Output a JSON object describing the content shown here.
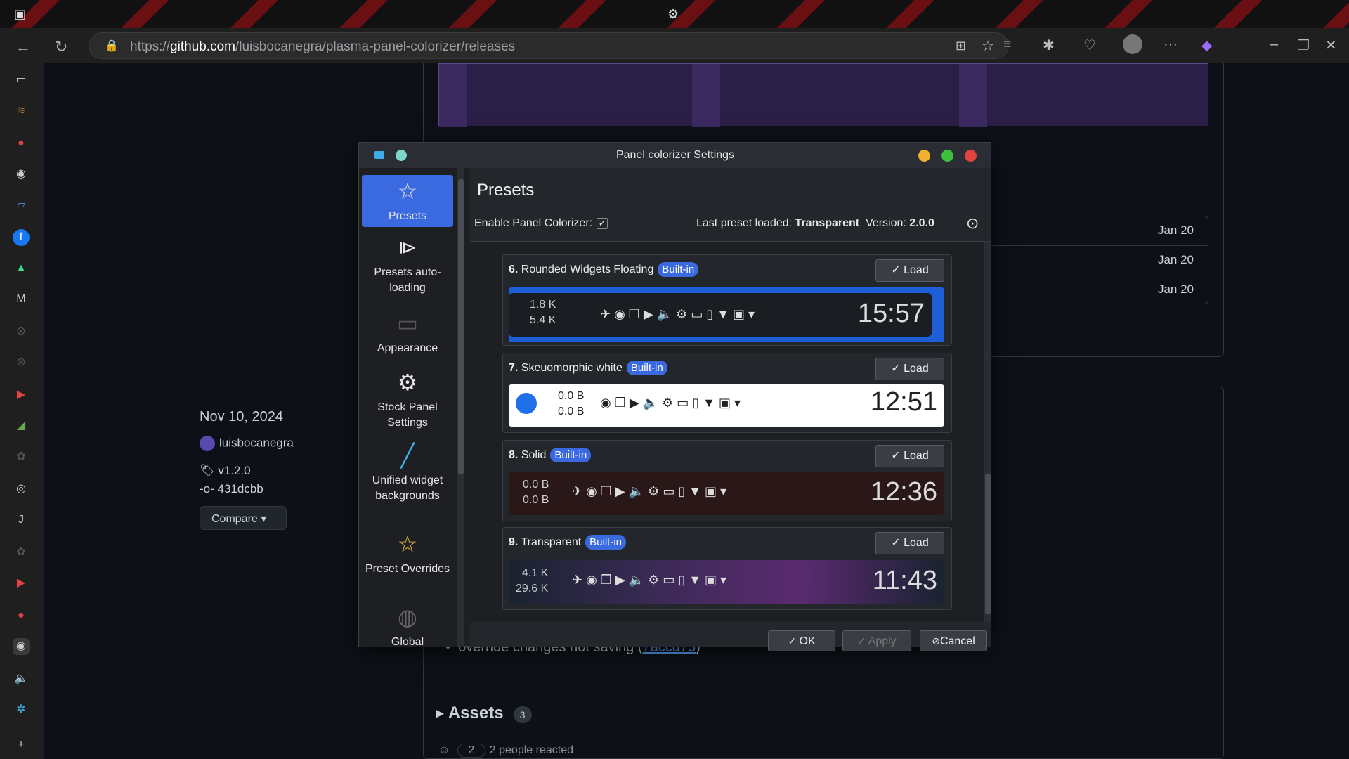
{
  "browser": {
    "url_prefix": "https://",
    "url_domain": "github.com",
    "url_path": "/luisbocanegra/plasma-panel-colorizer/releases"
  },
  "page": {
    "dates": [
      "Jan 20",
      "Jan 20",
      "Jan 20"
    ],
    "release_date": "Nov 10, 2024",
    "author": "luisbocanegra",
    "tag": "v1.2.0",
    "commit": "431dcbb",
    "compare_label": "Compare",
    "bullet_text": "override changes not saving (",
    "bullet_link": "7accd75",
    "bullet_end": ")",
    "assets_label": "Assets",
    "assets_count": "3",
    "reacted_count": "2",
    "reacted_text": "2 people reacted"
  },
  "dialog": {
    "title": "Panel colorizer Settings",
    "nav": [
      {
        "label": "Presets",
        "icon": "star-icon"
      },
      {
        "label": "Presets auto-loading",
        "icon": "play-icon"
      },
      {
        "label": "Appearance",
        "icon": "appearance-icon"
      },
      {
        "label": "Stock Panel Settings",
        "icon": "gear-icon"
      },
      {
        "label": "Unified widget backgrounds",
        "icon": "brush-icon"
      },
      {
        "label": "Preset Overrides",
        "icon": "star-pen-icon"
      },
      {
        "label": "Global",
        "icon": "globe-icon"
      }
    ],
    "heading": "Presets",
    "enable_label": "Enable Panel Colorizer:",
    "last_preset_label": "Last preset loaded:",
    "last_preset_value": "Transparent",
    "version_label": "Version:",
    "version_value": "2.0.0",
    "presets": [
      {
        "num": "6.",
        "name": "Rounded Widgets Floating",
        "badge": "Built-in",
        "load": "Load",
        "net1": "1.8 K",
        "net2": "5.4 K",
        "clock": "15:57"
      },
      {
        "num": "7.",
        "name": "Skeuomorphic white",
        "badge": "Built-in",
        "load": "Load",
        "net1": "0.0 B",
        "net2": "0.0 B",
        "clock": "12:51"
      },
      {
        "num": "8.",
        "name": "Solid",
        "badge": "Built-in",
        "load": "Load",
        "net1": "0.0 B",
        "net2": "0.0 B",
        "clock": "12:36"
      },
      {
        "num": "9.",
        "name": "Transparent",
        "badge": "Built-in",
        "load": "Load",
        "net1": "4.1 K",
        "net2": "29.6 K",
        "clock": "11:43"
      }
    ],
    "ok_label": "OK",
    "apply_label": "Apply",
    "cancel_label": "Cancel"
  },
  "colors": {
    "accent": "#3a69e0",
    "close": "#e0443e",
    "minimize": "#f0b030",
    "maximize": "#3fbf3f"
  }
}
